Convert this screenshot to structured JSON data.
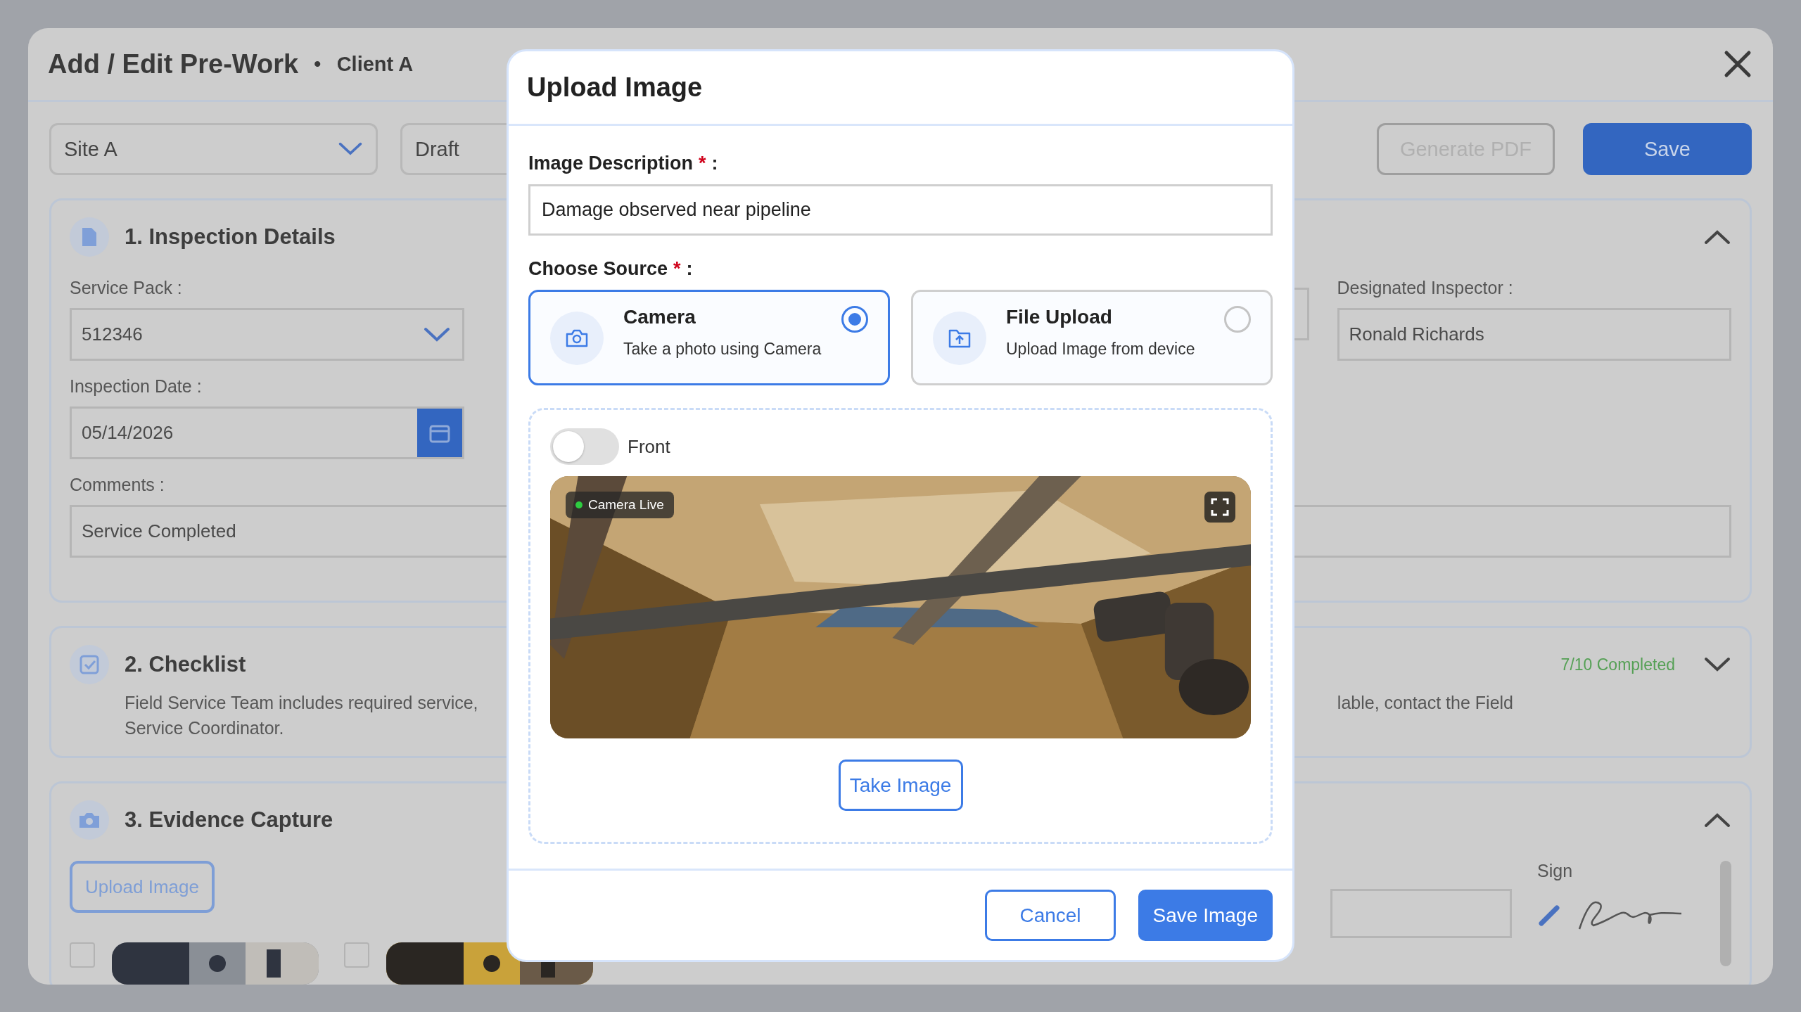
{
  "window": {
    "title": "Add / Edit Pre-Work",
    "separator": "•",
    "client": "Client A"
  },
  "toolbar": {
    "site": "Site A",
    "status": "Draft",
    "buttons": [
      {
        "label": "Generate PDF",
        "disabled": true
      },
      {
        "label": "Save",
        "disabled": false
      }
    ]
  },
  "inspection_details": {
    "title": "1. Inspection Details",
    "expanded": true,
    "service_pack": {
      "label": "Service Pack :",
      "value": "512346"
    },
    "inspection_date": {
      "label": "Inspection Date :",
      "value": "05/14/2026"
    },
    "designated_inspector": {
      "label": "Designated Inspector :",
      "value": "Ronald Richards"
    },
    "comments": {
      "label": "Comments :",
      "value": "Service Completed"
    }
  },
  "checklist": {
    "title": "2. Checklist",
    "expanded": false,
    "progress": "7/10 Completed",
    "description_left": [
      "Field Service Team includes required service,",
      "Service Coordinator."
    ],
    "description_right": "lable, contact the Field"
  },
  "evidence_capture": {
    "title": "3. Evidence Capture",
    "expanded": true,
    "upload_button": "Upload Image",
    "sign_label": "Sign"
  },
  "modal": {
    "title": "Upload Image",
    "description": {
      "label": "Image Description",
      "mark": "*",
      "colon": ":",
      "value": "Damage observed near pipeline"
    },
    "source": {
      "label": "Choose Source",
      "mark": "*",
      "colon": ":",
      "options": [
        {
          "kind": "camera",
          "title": "Camera",
          "subtitle": "Take a photo using Camera",
          "selected": true
        },
        {
          "kind": "file",
          "title": "File Upload",
          "subtitle": "Upload Image from device",
          "selected": false
        }
      ]
    },
    "camera": {
      "front_toggle": {
        "label": "Front",
        "on": false
      },
      "badge": "Camera Live",
      "take_button": "Take Image"
    },
    "buttons": [
      {
        "kind": "secondary",
        "label": "Cancel"
      },
      {
        "kind": "primary",
        "label": "Save Image"
      }
    ]
  }
}
